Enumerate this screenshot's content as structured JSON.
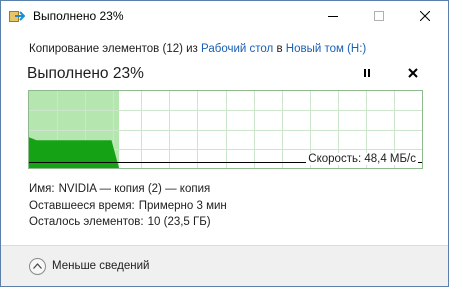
{
  "window": {
    "title": "Выполнено 23%",
    "icon": "file-copy-icon",
    "controls": [
      "minimize-icon",
      "maximize-icon",
      "close-icon"
    ]
  },
  "operation": {
    "prefix": "Копирование элементов (12) из",
    "source": "Рабочий стол",
    "middle": "в",
    "destination": "Новый том (H:)"
  },
  "progress": {
    "title": "Выполнено 23%",
    "percent": 23,
    "pause_icon": "pause-icon",
    "cancel_icon": "cancel-icon"
  },
  "graph": {
    "speed_text": "Скорость: 48,4 МБ/с",
    "completed_fraction": 0.23,
    "current_speed_fraction": 0.08,
    "speed_samples": [
      0.4,
      0.36,
      0.36,
      0.36,
      0.36,
      0.36,
      0.36,
      0.36,
      0.36,
      0.36,
      0.36,
      0.36,
      0.0
    ],
    "colors": {
      "fill_done": "#b5e6b0",
      "speed_area": "#15a315",
      "grid": "#cde4cd",
      "border": "#8fb98f",
      "current_line": "#000000"
    }
  },
  "details": {
    "name_label": "Имя:",
    "name_value": "NVIDIA — копия (2) — копия",
    "time_label": "Оставшееся время:",
    "time_value": "Примерно 3 мин",
    "items_label": "Осталось элементов:",
    "items_value": "10 (23,5 ГБ)"
  },
  "footer": {
    "less_label": "Меньше сведений",
    "icon": "chevron-up-icon"
  }
}
